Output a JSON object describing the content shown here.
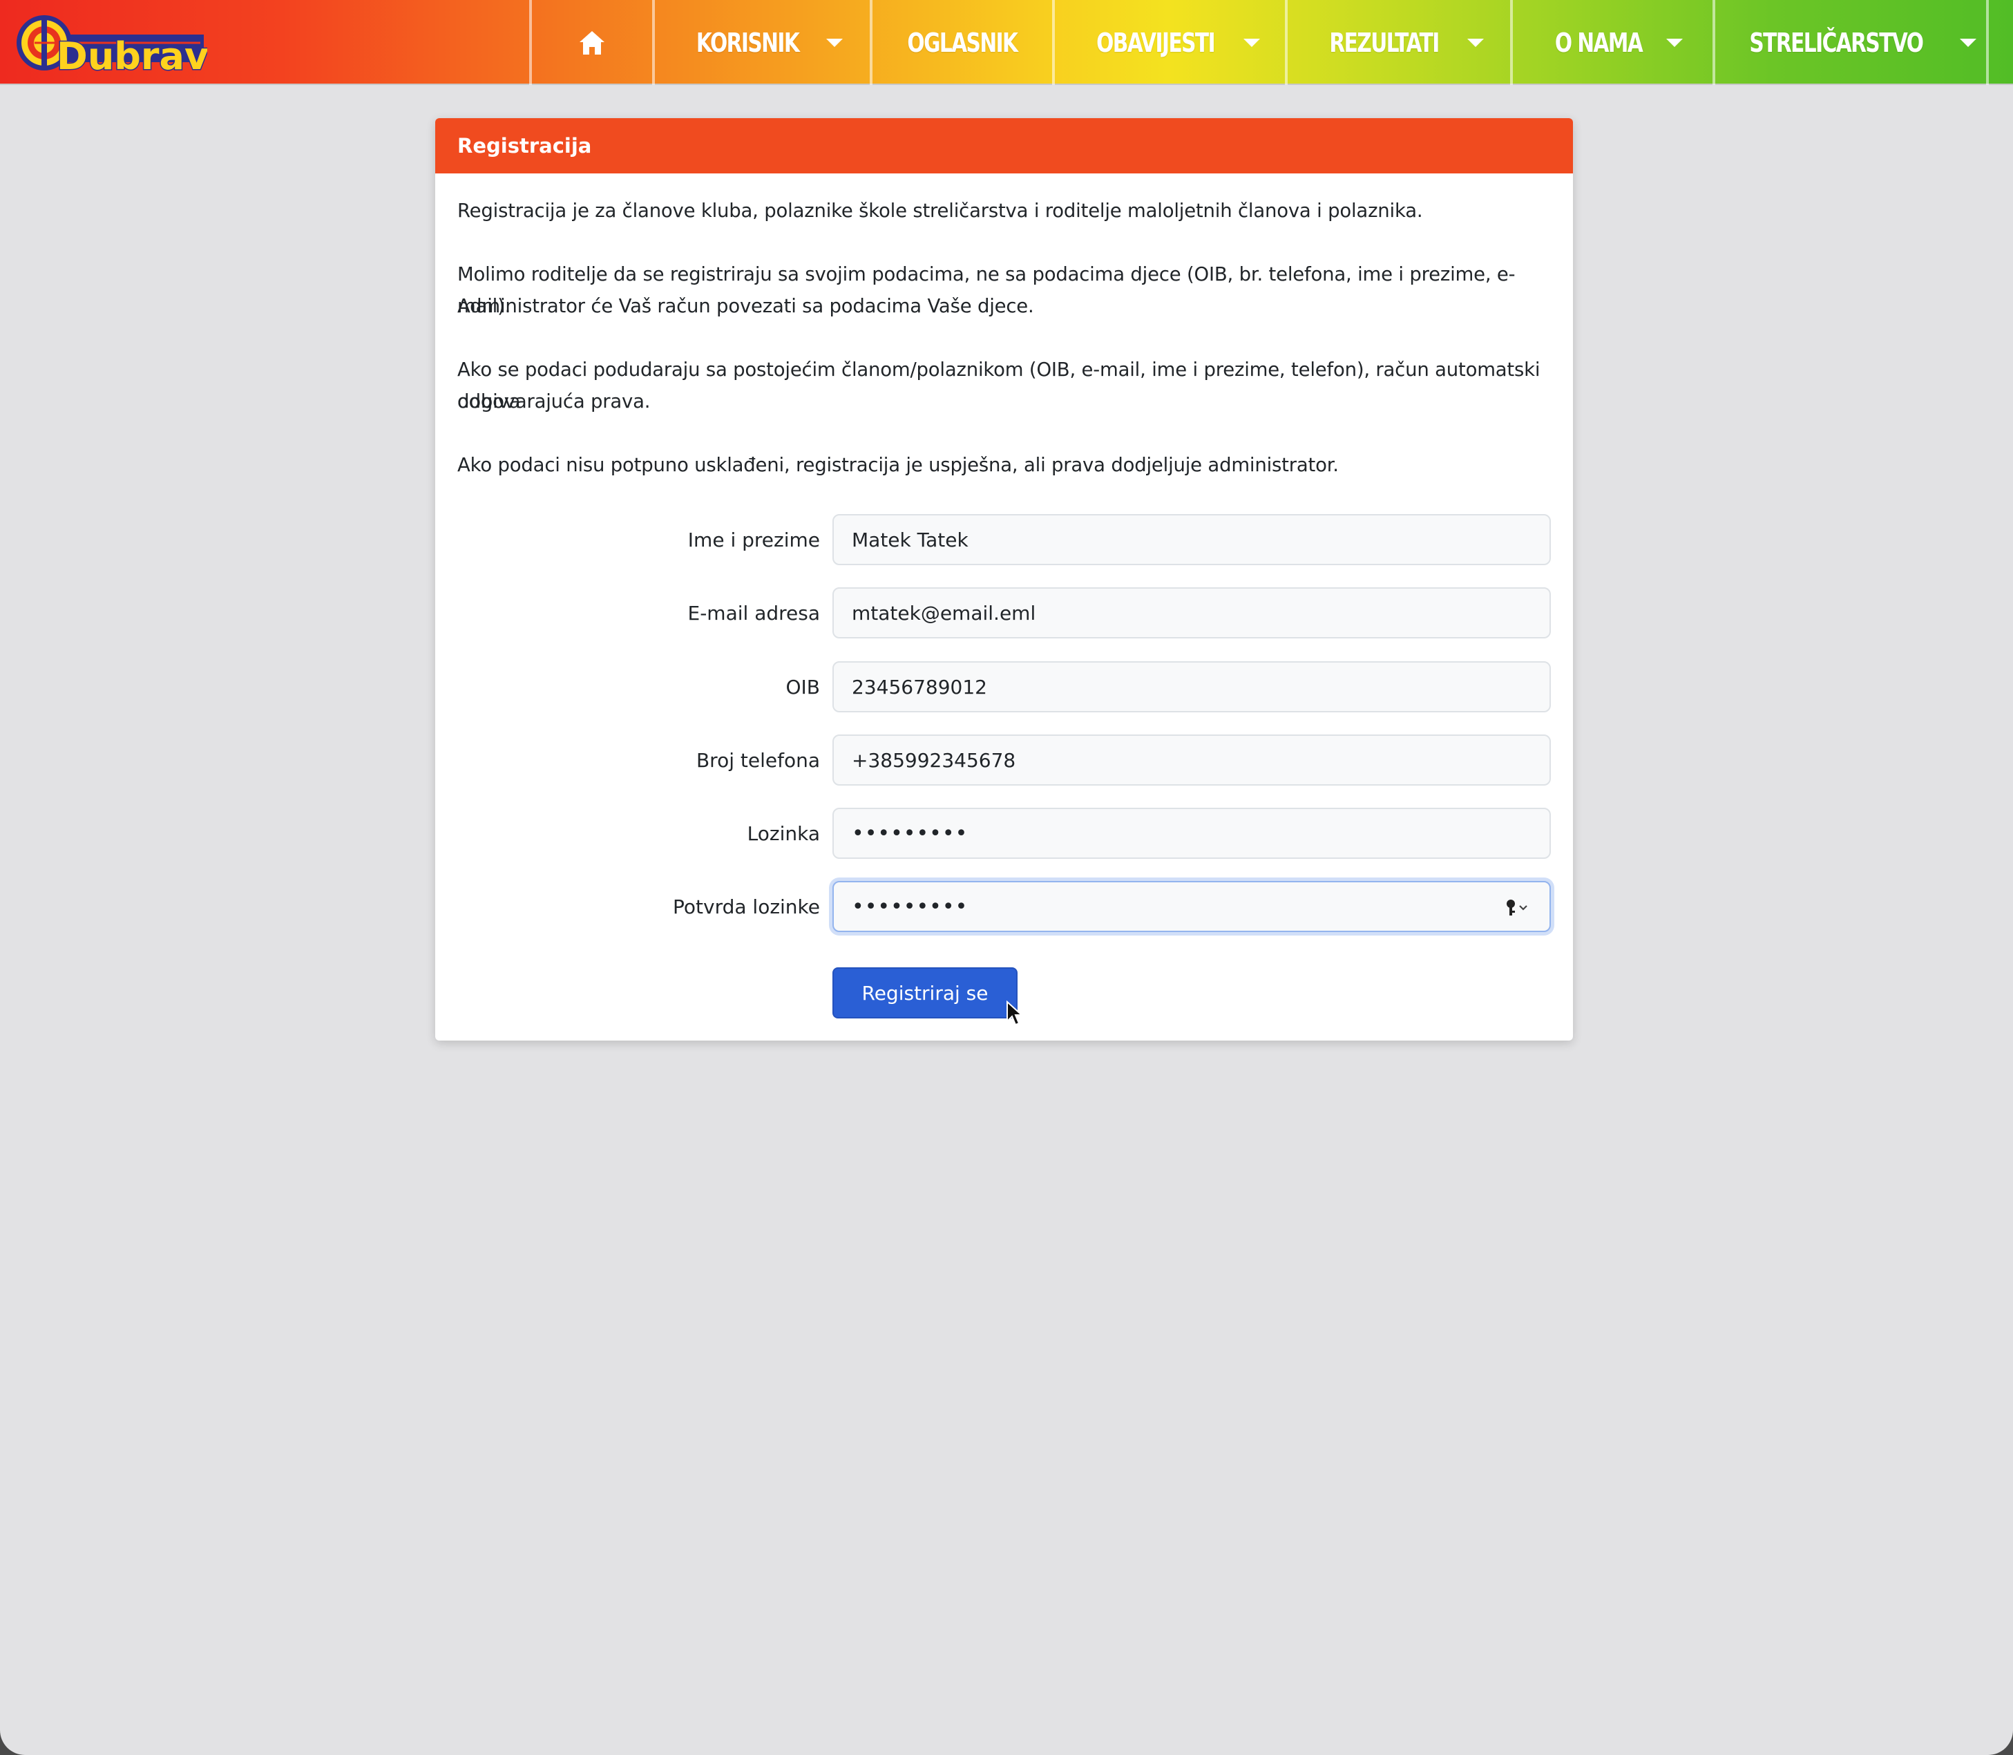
{
  "header": {
    "logo_text": "Dubrava",
    "nav": [
      {
        "label": "",
        "icon": "home-icon"
      },
      {
        "label": "KORISNIK",
        "dropdown": true
      },
      {
        "label": "OGLASNIK",
        "dropdown": false
      },
      {
        "label": "OBAVIJESTI",
        "dropdown": true
      },
      {
        "label": "REZULTATI",
        "dropdown": true
      },
      {
        "label": "O NAMA",
        "dropdown": true
      },
      {
        "label": "STRELIČARSTVO",
        "dropdown": true
      }
    ]
  },
  "card": {
    "title": "Registracija",
    "paragraphs": [
      "Registracija je za članove kluba, polaznike škole streličarstva i roditelje maloljetnih članova i polaznika.",
      "Molimo roditelje da se registriraju sa svojim podacima, ne sa podacima djece (OIB, br. telefona, ime i prezime, e-mail).",
      "Administrator će Vaš račun povezati sa podacima Vaše djece.",
      "Ako se podaci podudaraju sa postojećim članom/polaznikom (OIB, e-mail, ime i prezime, telefon), račun automatski dobiva",
      "odgovarajuća prava.",
      "Ako podaci nisu potpuno usklađeni, registracija je uspješna, ali prava dodjeljuje administrator."
    ]
  },
  "form": {
    "fields": [
      {
        "label": "Ime i prezime",
        "value": "Matek Tatek"
      },
      {
        "label": "E-mail adresa",
        "value": "mtatek@email.eml"
      },
      {
        "label": "OIB",
        "value": "23456789012"
      },
      {
        "label": "Broj telefona",
        "value": "+385992345678"
      },
      {
        "label": "Lozinka",
        "value": "•••••••••"
      },
      {
        "label": "Potvrda lozinke",
        "value": "•••••••••"
      }
    ],
    "submit_label": "Registriraj se"
  },
  "colors": {
    "header_accent": "#f04b1f",
    "button": "#2a5fd5",
    "page_bg": "#e2e2e4"
  }
}
